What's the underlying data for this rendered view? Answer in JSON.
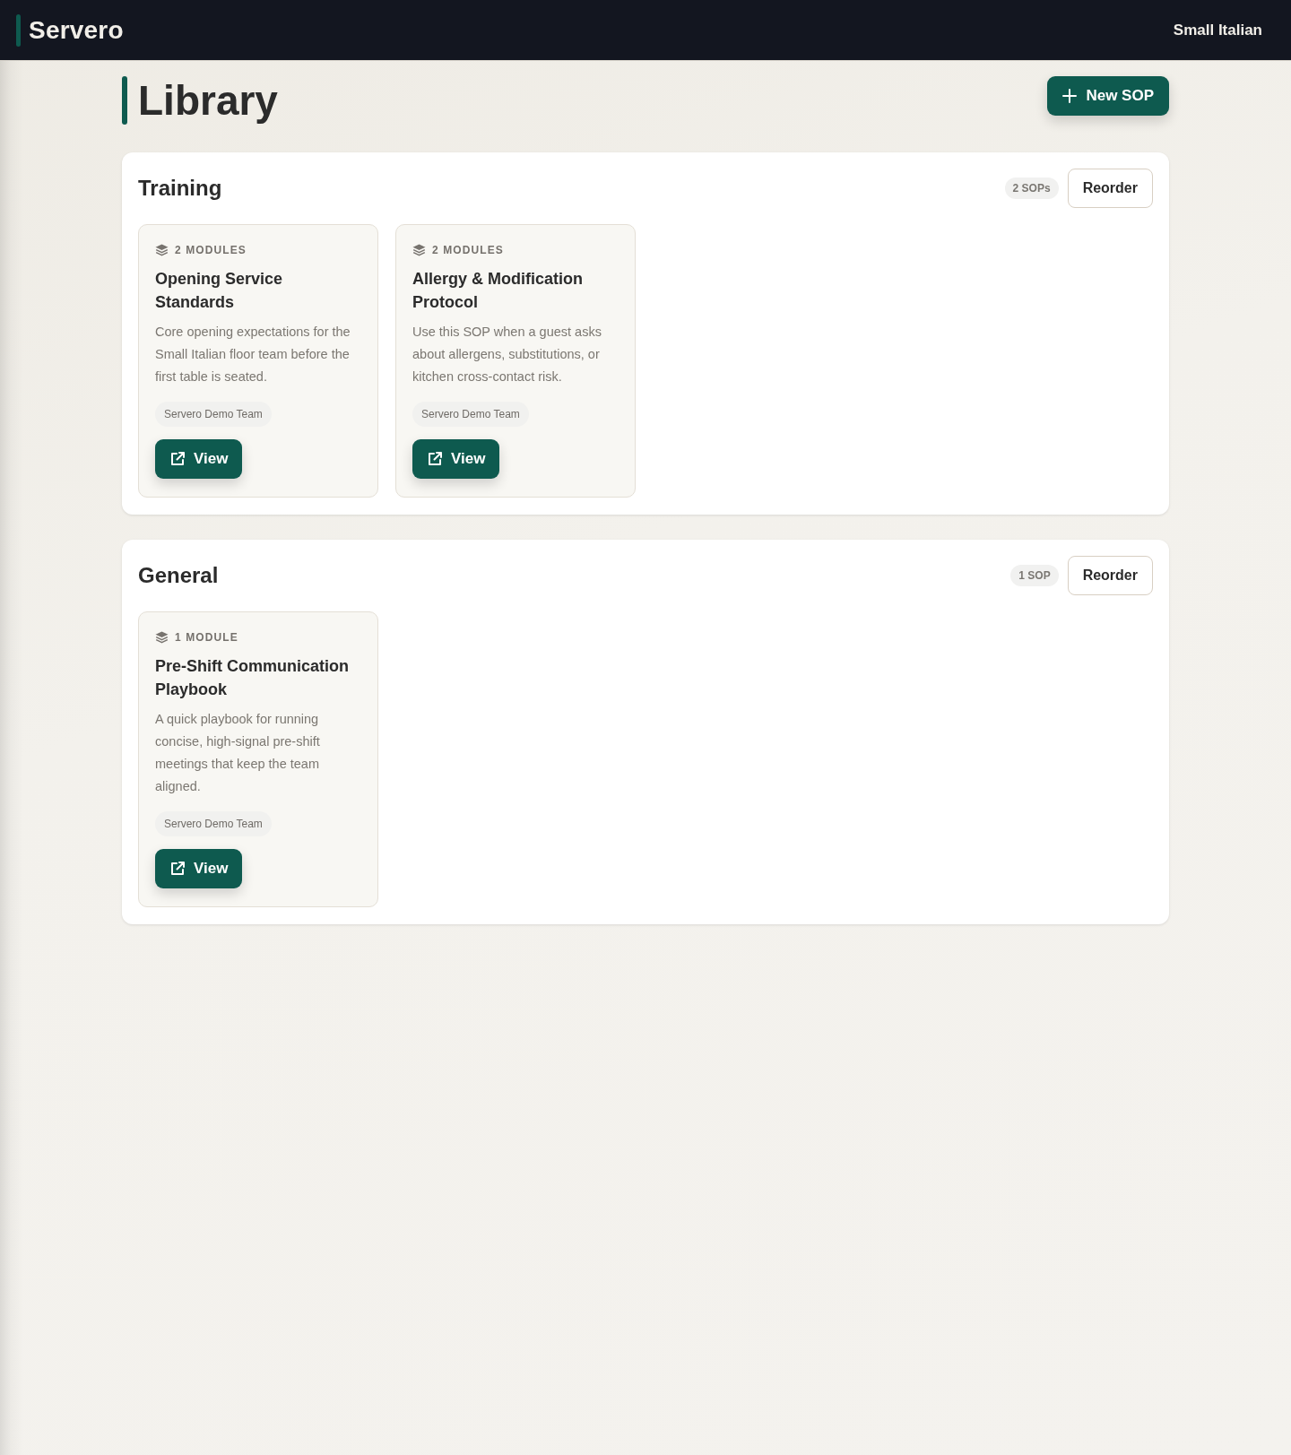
{
  "header": {
    "brand": "Servero",
    "location": "Small Italian"
  },
  "page": {
    "title": "Library",
    "new_button": "New SOP"
  },
  "sections": [
    {
      "title": "Training",
      "count": "2 SOPs",
      "reorder_button": "Reorder",
      "sops": [
        {
          "modules": "2 MODULES",
          "title": "Opening Service Standards",
          "description": "Core opening expectations for the Small Italian floor team before the first table is seated.",
          "team": "Servero Demo Team",
          "view_button": "View"
        },
        {
          "modules": "2 MODULES",
          "title": "Allergy & Modification Protocol",
          "description": "Use this SOP when a guest asks about allergens, substitutions, or kitchen cross-contact risk.",
          "team": "Servero Demo Team",
          "view_button": "View"
        }
      ]
    },
    {
      "title": "General",
      "count": "1 SOP",
      "reorder_button": "Reorder",
      "sops": [
        {
          "modules": "1 MODULE",
          "title": "Pre-Shift Communication Playbook",
          "description": "A quick playbook for running concise, high-signal pre-shift meetings that keep the team aligned.",
          "team": "Servero Demo Team",
          "view_button": "View"
        }
      ]
    }
  ]
}
